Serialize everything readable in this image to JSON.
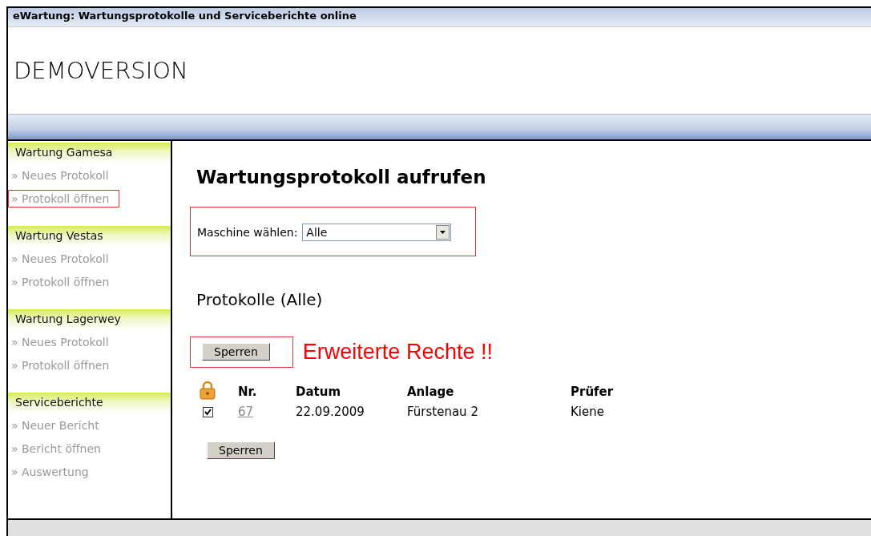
{
  "window": {
    "title": "eWartung: Wartungsprotokolle und Serviceberichte online"
  },
  "header": {
    "title": "DEMOVERSION"
  },
  "sidebar": {
    "sections": [
      {
        "title": "Wartung Gamesa",
        "items": [
          {
            "label": "» Neues Protokoll",
            "highlighted": false
          },
          {
            "label": "» Protokoll öffnen",
            "highlighted": true
          }
        ]
      },
      {
        "title": "Wartung Vestas",
        "items": [
          {
            "label": "» Neues Protokoll",
            "highlighted": false
          },
          {
            "label": "» Protokoll öffnen",
            "highlighted": false
          }
        ]
      },
      {
        "title": "Wartung Lagerwey",
        "items": [
          {
            "label": "» Neues Protokoll",
            "highlighted": false
          },
          {
            "label": "» Protokoll öffnen",
            "highlighted": false
          }
        ]
      },
      {
        "title": "Serviceberichte",
        "items": [
          {
            "label": "» Neuer Bericht",
            "highlighted": false
          },
          {
            "label": "» Bericht öffnen",
            "highlighted": false
          },
          {
            "label": "» Auswertung",
            "highlighted": false
          }
        ]
      }
    ]
  },
  "content": {
    "heading": "Wartungsprotokoll aufrufen",
    "machine_select": {
      "label": "Maschine wählen:",
      "value": "Alle",
      "highlighted": true
    },
    "subheading": "Protokolle (Alle)",
    "top_button": {
      "label": "Sperren",
      "highlighted": true
    },
    "note": "Erweiterte Rechte !!",
    "table": {
      "columns": [
        "Nr.",
        "Datum",
        "Anlage",
        "Prüfer"
      ],
      "rows": [
        {
          "checked": true,
          "nr": "67",
          "datum": "22.09.2009",
          "anlage": "Fürstenau 2",
          "pruefer": "Kiene"
        }
      ]
    },
    "bottom_button": {
      "label": "Sperren"
    }
  }
}
